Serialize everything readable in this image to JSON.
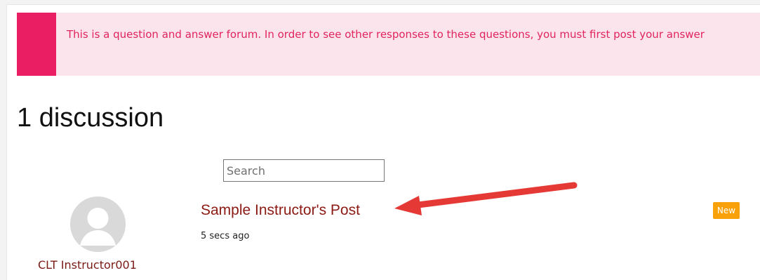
{
  "notice": {
    "text": "This is a question and answer forum. In order to see other responses to these questions, you must first post your answer"
  },
  "discussions": {
    "count_label": "1 discussion"
  },
  "search": {
    "placeholder": "Search"
  },
  "post": {
    "title": "Sample Instructor's Post",
    "time": "5 secs ago",
    "badge": "New",
    "author": "CLT Instructor001"
  },
  "colors": {
    "notice_bar": "#e91e63",
    "notice_bg": "#fce4ec",
    "notice_text": "#e0245e",
    "link": "#8b1a14",
    "badge": "#f9a10b",
    "annotation_arrow": "#e53935"
  },
  "icons": {
    "avatar": "default-user-avatar-icon",
    "annotation": "red-arrow-annotation"
  }
}
